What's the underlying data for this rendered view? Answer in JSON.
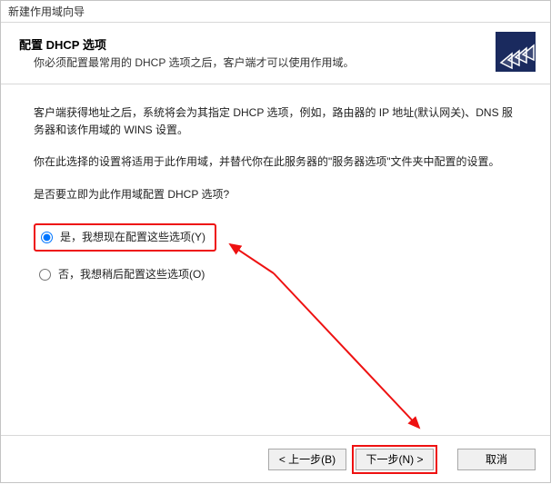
{
  "window": {
    "title": "新建作用域向导"
  },
  "header": {
    "title": "配置 DHCP 选项",
    "subtitle": "你必须配置最常用的 DHCP 选项之后，客户端才可以使用作用域。",
    "icon_name": "dhcp-wizard-icon"
  },
  "body": {
    "para1": "客户端获得地址之后，系统将会为其指定 DHCP 选项，例如，路由器的 IP 地址(默认网关)、DNS 服务器和该作用域的 WINS 设置。",
    "para2": "你在此选择的设置将适用于此作用域，并替代你在此服务器的\"服务器选项\"文件夹中配置的设置。",
    "question": "是否要立即为此作用域配置 DHCP 选项?",
    "options": {
      "yes_label": "是，我想现在配置这些选项(Y)",
      "no_label": "否，我想稍后配置这些选项(O)",
      "selected": "yes"
    }
  },
  "buttons": {
    "back": "< 上一步(B)",
    "next": "下一步(N) >",
    "cancel": "取消"
  }
}
